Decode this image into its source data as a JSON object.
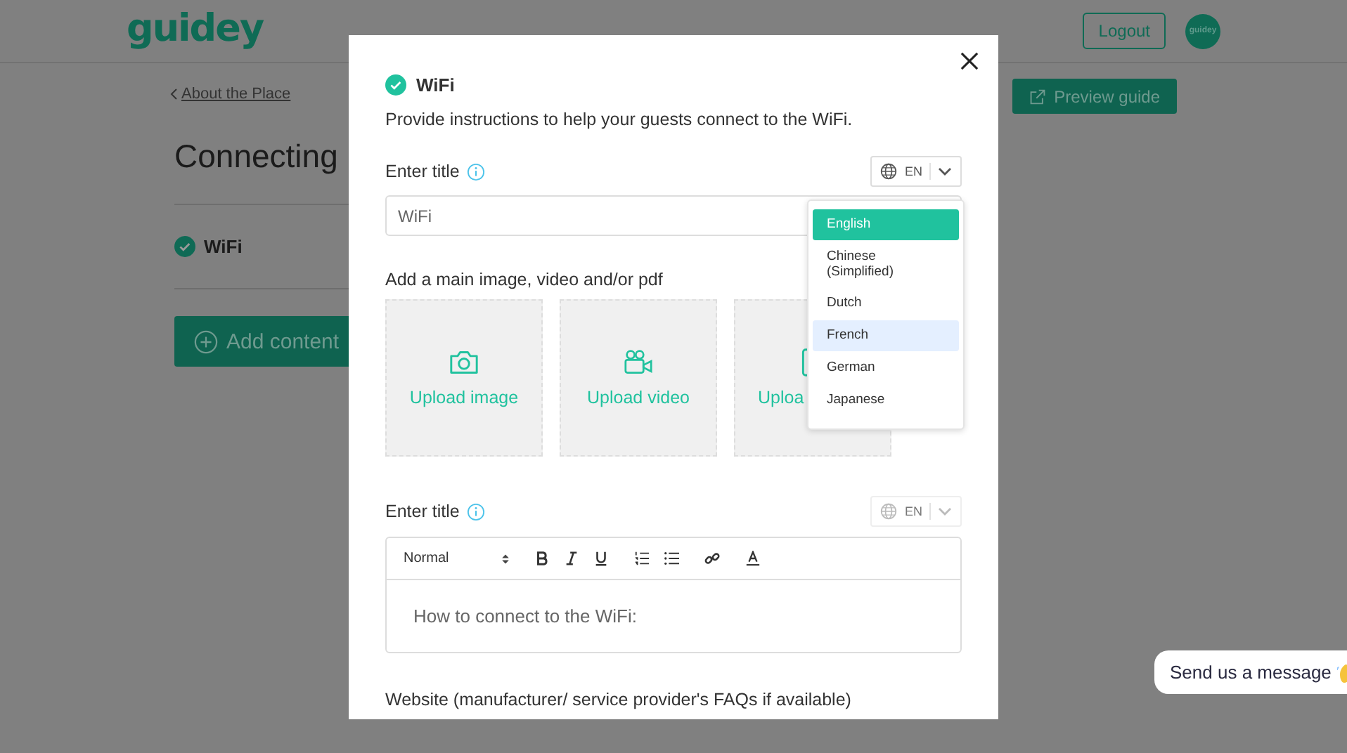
{
  "header": {
    "logo": "guidey",
    "logout": "Logout",
    "avatar": "guidey"
  },
  "page": {
    "back_link": "About the Place",
    "title": "Connecting",
    "items": [
      {
        "label": "WiFi",
        "checked": true
      }
    ],
    "add_button": "Add content",
    "preview_button": "Preview guide"
  },
  "modal": {
    "title": "WiFi",
    "checked": true,
    "description": "Provide instructions to help your guests connect to the WiFi.",
    "title_field": {
      "label": "Enter title",
      "value": "WiFi",
      "language": "EN",
      "disabled": false
    },
    "media_label": "Add a main image, video and/or pdf",
    "uploads": [
      {
        "kind": "image",
        "label": "Upload image"
      },
      {
        "kind": "video",
        "label": "Upload video"
      },
      {
        "kind": "file",
        "label": "Uploa"
      }
    ],
    "languages": [
      {
        "label": "English",
        "selected": true,
        "highlighted": false
      },
      {
        "label": "Chinese (Simplified)",
        "selected": false,
        "highlighted": false
      },
      {
        "label": "Dutch",
        "selected": false,
        "highlighted": false
      },
      {
        "label": "French",
        "selected": false,
        "highlighted": true
      },
      {
        "label": "German",
        "selected": false,
        "highlighted": false
      },
      {
        "label": "Japanese",
        "selected": false,
        "highlighted": false
      }
    ],
    "editor": {
      "label": "Enter title",
      "language": "EN",
      "disabled": true,
      "style": "Normal",
      "body": "How to connect to the WiFi:"
    },
    "website_label": "Website (manufacturer/ service provider's FAQs if available)"
  },
  "chat": {
    "label": "Send us a message"
  }
}
